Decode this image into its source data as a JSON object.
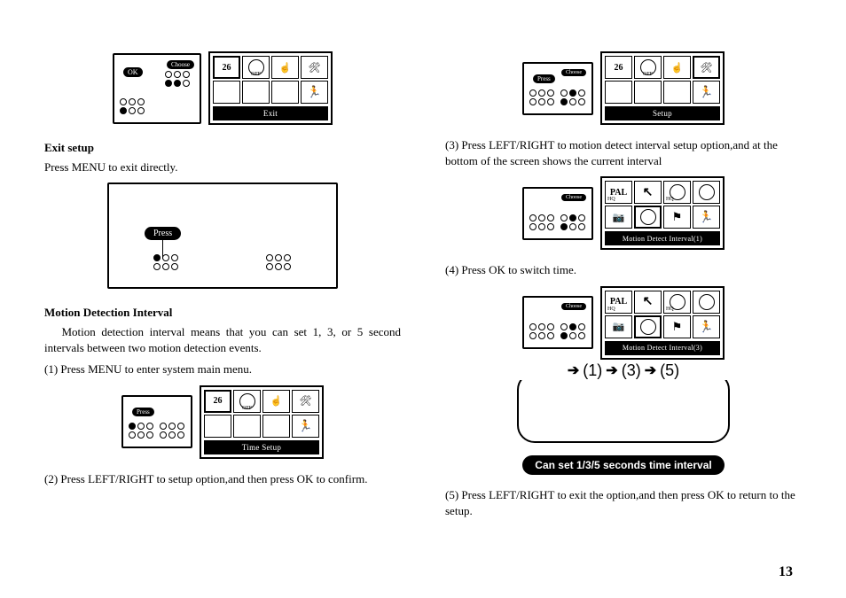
{
  "left": {
    "exit_heading": "Exit setup",
    "exit_body": "Press MENU to exit directly.",
    "mdi_heading": "Motion Detection Interval",
    "mdi_body": "Motion detection interval means that you can set 1, 3, or 5 second intervals between two motion detection events.",
    "step1": "(1) Press MENU to enter system main menu.",
    "step2": "(2) Press LEFT/RIGHT to setup option,and then press OK to confirm."
  },
  "right": {
    "step3": "(3)    Press LEFT/RIGHT to motion detect interval setup option,and at the bottom of the screen shows the current interval",
    "step4": "(4)    Press OK to switch time.",
    "step5": "(5)    Press LEFT/RIGHT to exit the option,and then press OK to return to the setup."
  },
  "labels": {
    "ok": "OK",
    "choose": "Choose",
    "press": "Press",
    "cal": "26",
    "off": "OFF",
    "pal": "PAL",
    "hq": "HQ"
  },
  "bars": {
    "exit": "Exit",
    "setup": "Setup",
    "time_setup": "Time Setup",
    "mdi1": "Motion Detect Interval(1)",
    "mdi3": "Motion Detect Interval(3)"
  },
  "cycle": {
    "a": "(1)",
    "b": "(3)",
    "c": "(5)"
  },
  "cycle_caption": "Can set 1/3/5 seconds time interval",
  "page": "13"
}
